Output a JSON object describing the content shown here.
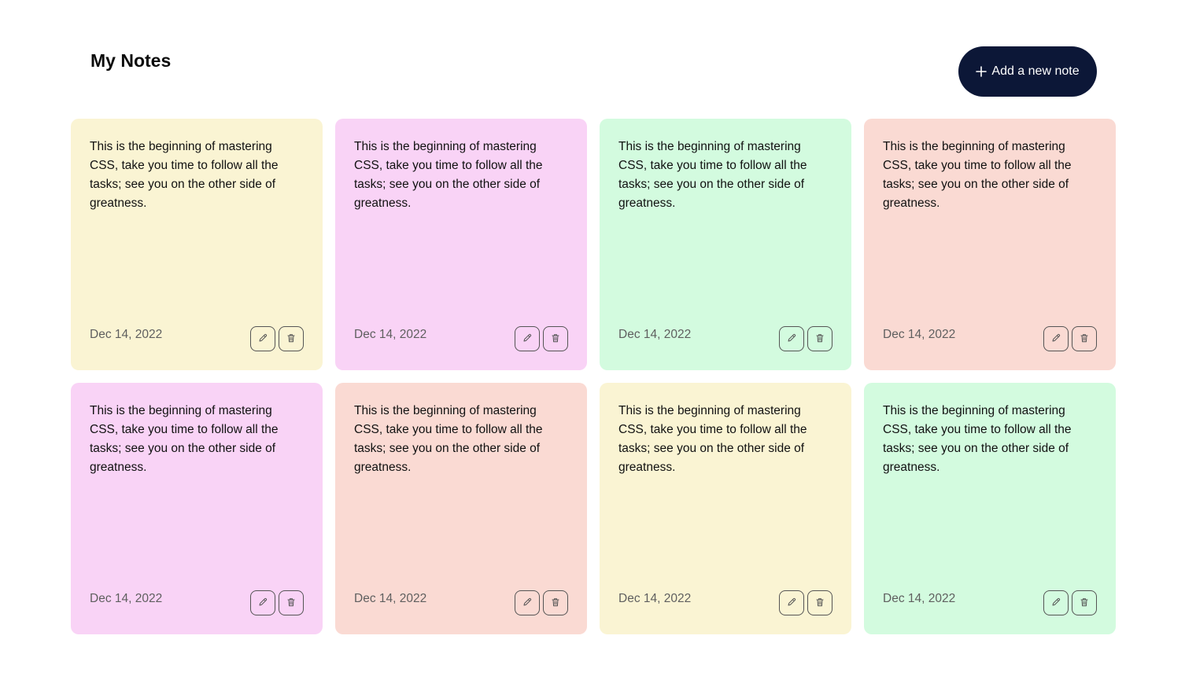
{
  "header": {
    "title": "My Notes",
    "add_button_label": "Add a new note",
    "add_button_icon": "plus-icon"
  },
  "colors": {
    "yellow": "#faf4d3",
    "pink": "#f9d3f6",
    "green": "#d3fbdf",
    "salmon": "#fadad3",
    "button_dark": "#0c1737"
  },
  "notes": [
    {
      "text": "This is the beginning of mastering CSS, take you time to follow all the tasks; see you on the other side of greatness.",
      "date": "Dec 14, 2022",
      "color": "#faf4d3",
      "edit_icon": "pencil-icon",
      "delete_icon": "trash-icon"
    },
    {
      "text": "This is the beginning of mastering CSS, take you time to follow all the tasks; see you on the other side of greatness.",
      "date": "Dec 14, 2022",
      "color": "#f9d3f6",
      "edit_icon": "pencil-icon",
      "delete_icon": "trash-icon"
    },
    {
      "text": "This is the beginning of mastering CSS, take you time to follow all the tasks; see you on the other side of greatness.",
      "date": "Dec 14, 2022",
      "color": "#d3fbdf",
      "edit_icon": "pencil-icon",
      "delete_icon": "trash-icon"
    },
    {
      "text": "This is the beginning of mastering CSS, take you time to follow all the tasks; see you on the other side of greatness.",
      "date": "Dec 14, 2022",
      "color": "#fadad3",
      "edit_icon": "pencil-icon",
      "delete_icon": "trash-icon"
    },
    {
      "text": "This is the beginning of mastering CSS, take you time to follow all the tasks; see you on the other side of greatness.",
      "date": "Dec 14, 2022",
      "color": "#f9d3f6",
      "edit_icon": "pencil-icon",
      "delete_icon": "trash-icon"
    },
    {
      "text": "This is the beginning of mastering CSS, take you time to follow all the tasks; see you on the other side of greatness.",
      "date": "Dec 14, 2022",
      "color": "#fadad3",
      "edit_icon": "pencil-icon",
      "delete_icon": "trash-icon"
    },
    {
      "text": "This is the beginning of mastering CSS, take you time to follow all the tasks; see you on the other side of greatness.",
      "date": "Dec 14, 2022",
      "color": "#faf4d3",
      "edit_icon": "pencil-icon",
      "delete_icon": "trash-icon"
    },
    {
      "text": "This is the beginning of mastering CSS, take you time to follow all the tasks; see you on the other side of greatness.",
      "date": "Dec 14, 2022",
      "color": "#d3fbdf",
      "edit_icon": "pencil-icon",
      "delete_icon": "trash-icon"
    }
  ]
}
